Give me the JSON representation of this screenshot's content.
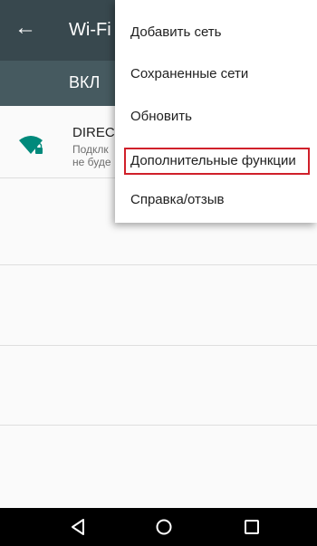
{
  "app": {
    "title": "Wi-Fi",
    "back_icon": "arrow-left-icon"
  },
  "switch_bar": {
    "label": "ВКЛ"
  },
  "network": {
    "name": "DIRECT",
    "subtitle_line1": "Подклк",
    "subtitle_line2": "не буде",
    "icon": "wifi-lock-icon",
    "icon_color": "#00897b"
  },
  "overflow_menu": {
    "items": [
      {
        "label": "Добавить сеть"
      },
      {
        "label": "Сохраненные сети"
      },
      {
        "label": "Обновить"
      },
      {
        "label": "Дополнительные функции",
        "highlighted": true
      },
      {
        "label": "Справка/отзыв"
      }
    ],
    "highlight_color": "#d0202a"
  },
  "nav_bar": {
    "back_icon": "triangle-back-icon",
    "home_icon": "circle-home-icon",
    "recents_icon": "square-recents-icon"
  }
}
